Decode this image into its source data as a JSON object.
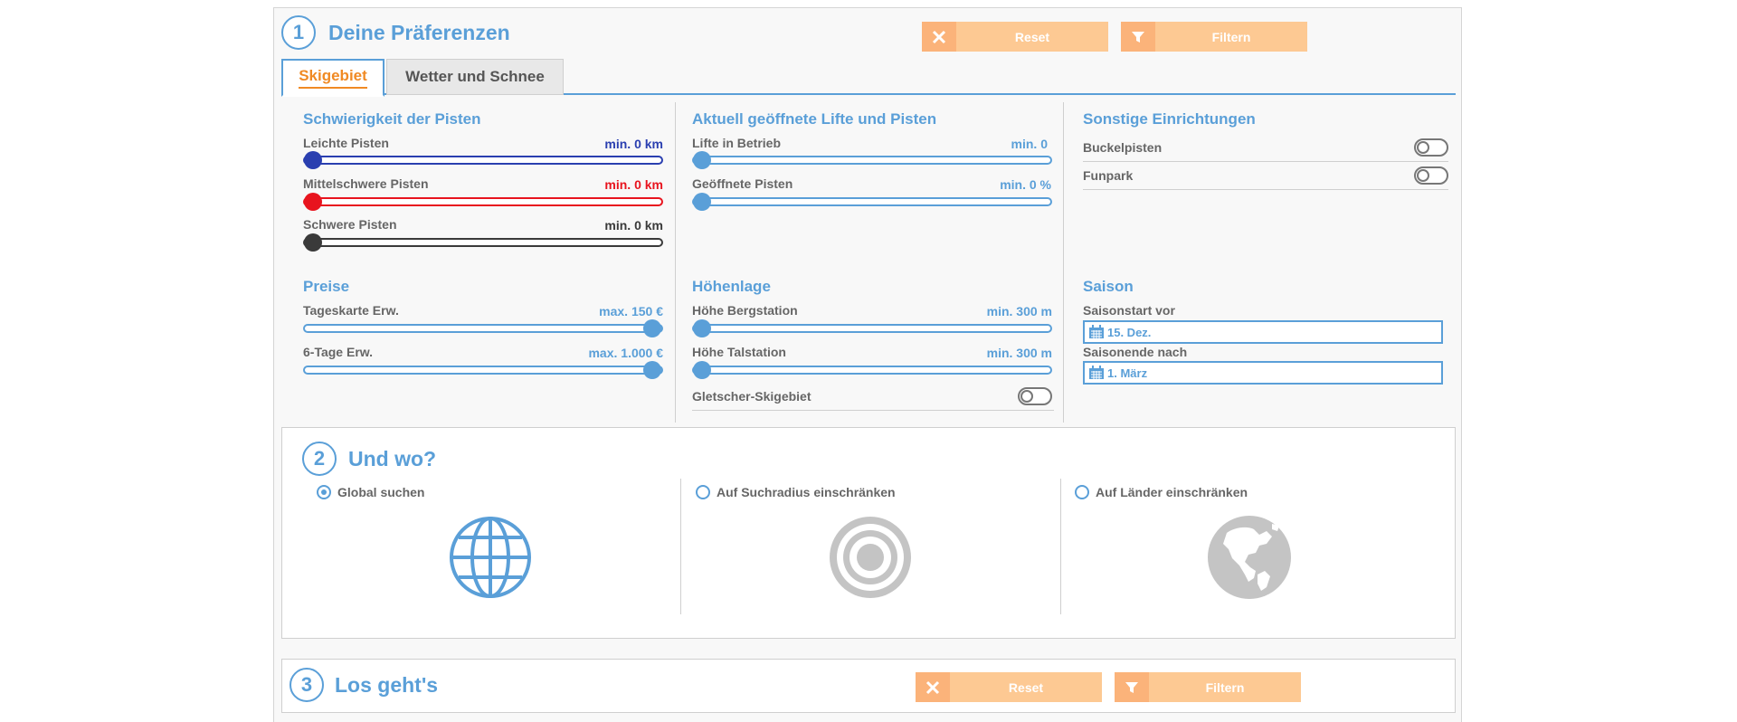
{
  "section1": {
    "number": "1",
    "title": "Deine Präferenzen",
    "reset_label": "Reset",
    "filter_label": "Filtern",
    "tabs": [
      {
        "label": "Skigebiet",
        "active": true
      },
      {
        "label": "Wetter und Schnee",
        "active": false
      }
    ],
    "difficulty": {
      "title": "Schwierigkeit der Pisten",
      "rows": [
        {
          "label": "Leichte Pisten",
          "value": "min. 0 km",
          "color": "#2a3fb0",
          "level": 0
        },
        {
          "label": "Mittelschwere Pisten",
          "value": "min. 0 km",
          "color": "#e8141e",
          "level": 0
        },
        {
          "label": "Schwere Pisten",
          "value": "min. 0 km",
          "color": "#3a3a3a",
          "level": 0
        }
      ]
    },
    "open": {
      "title": "Aktuell geöffnete Lifte und Pisten",
      "rows": [
        {
          "label": "Lifte in Betrieb",
          "value": "min. 0",
          "color": "#5a9fd8",
          "level": 0
        },
        {
          "label": "Geöffnete Pisten",
          "value": "min. 0 %",
          "color": "#5a9fd8",
          "level": 0
        }
      ]
    },
    "other": {
      "title": "Sonstige Einrichtungen",
      "toggles": [
        {
          "label": "Buckelpisten",
          "on": false
        },
        {
          "label": "Funpark",
          "on": false
        }
      ]
    },
    "prices": {
      "title": "Preise",
      "rows": [
        {
          "label": "Tageskarte Erw.",
          "value": "max. 150 €",
          "color": "#5a9fd8",
          "level": 1
        },
        {
          "label": "6-Tage Erw.",
          "value": "max. 1.000 €",
          "color": "#5a9fd8",
          "level": 1
        }
      ]
    },
    "altitude": {
      "title": "Höhenlage",
      "rows": [
        {
          "label": "Höhe Bergstation",
          "value": "min. 300 m",
          "color": "#5a9fd8",
          "level": 0
        },
        {
          "label": "Höhe Talstation",
          "value": "min. 300 m",
          "color": "#5a9fd8",
          "level": 0
        }
      ],
      "glacier_label": "Gletscher-Skigebiet"
    },
    "season": {
      "title": "Saison",
      "start_label": "Saisonstart vor",
      "start_value": "15. Dez.",
      "end_label": "Saisonende nach",
      "end_value": "1. März"
    }
  },
  "section2": {
    "number": "2",
    "title": "Und wo?",
    "options": [
      {
        "label": "Global suchen",
        "selected": true,
        "icon": "globe-grid-icon"
      },
      {
        "label": "Auf Suchradius einschränken",
        "selected": false,
        "icon": "target-icon"
      },
      {
        "label": "Auf Länder einschränken",
        "selected": false,
        "icon": "earth-americas-icon"
      }
    ]
  },
  "section3": {
    "number": "3",
    "title": "Los geht's",
    "reset_label": "Reset",
    "filter_label": "Filtern"
  },
  "colors": {
    "accent_blue": "#5a9fd8",
    "orange_tab": "#f08a24",
    "button_orange": "#fdc993",
    "easy_blue": "#2a3fb0",
    "medium_red": "#e8141e",
    "hard_dark": "#3a3a3a",
    "icon_gray": "#c4c4c4"
  }
}
